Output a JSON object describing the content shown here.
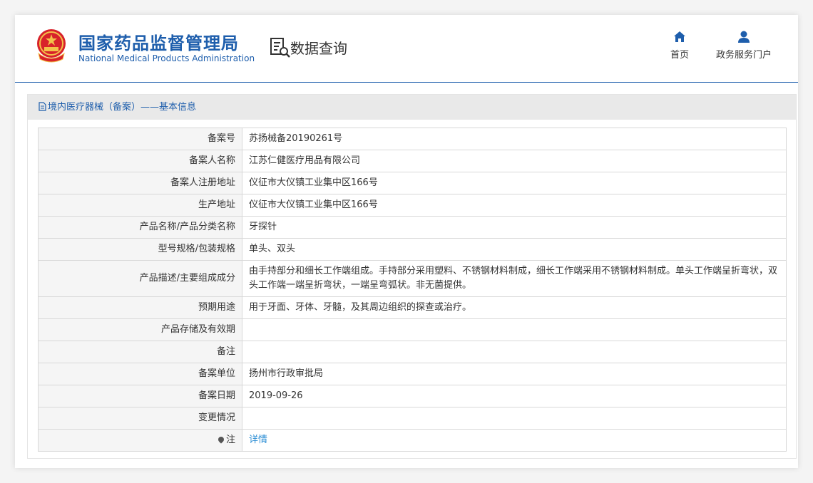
{
  "header": {
    "org_name_cn": "国家药品监督管理局",
    "org_name_en": "National Medical Products Administration",
    "page_title": "数据查询",
    "nav": [
      {
        "label": "首页",
        "icon": "home-icon"
      },
      {
        "label": "政务服务门户",
        "icon": "user-icon"
      }
    ]
  },
  "panel": {
    "title": "境内医疗器械（备案）——基本信息",
    "title_icon": "document-icon"
  },
  "rows": [
    {
      "label": "备案号",
      "value": "苏扬械备20190261号"
    },
    {
      "label": "备案人名称",
      "value": "江苏仁健医疗用品有限公司"
    },
    {
      "label": "备案人注册地址",
      "value": "仪征市大仪镇工业集中区166号"
    },
    {
      "label": "生产地址",
      "value": "仪征市大仪镇工业集中区166号"
    },
    {
      "label": "产品名称/产品分类名称",
      "value": "牙探针"
    },
    {
      "label": "型号规格/包装规格",
      "value": "单头、双头"
    },
    {
      "label": "产品描述/主要组成成分",
      "value": "由手持部分和细长工作端组成。手持部分采用塑料、不锈钢材料制成，细长工作端采用不锈钢材料制成。单头工作端呈折弯状，双头工作端一端呈折弯状，一端呈弯弧状。非无菌提供。"
    },
    {
      "label": "预期用途",
      "value": "用于牙面、牙体、牙髓，及其周边组织的探查或治疗。"
    },
    {
      "label": "产品存储及有效期",
      "value": ""
    },
    {
      "label": "备注",
      "value": ""
    },
    {
      "label": "备案单位",
      "value": "扬州市行政审批局"
    },
    {
      "label": "备案日期",
      "value": "2019-09-26"
    },
    {
      "label": "变更情况",
      "value": ""
    },
    {
      "label": "注",
      "value": "详情"
    }
  ],
  "colors": {
    "brand_blue": "#1e5eac",
    "link_blue": "#2a8dd4",
    "label_bg": "#f5f5f5",
    "panel_head_bg": "#e9e9e9"
  }
}
